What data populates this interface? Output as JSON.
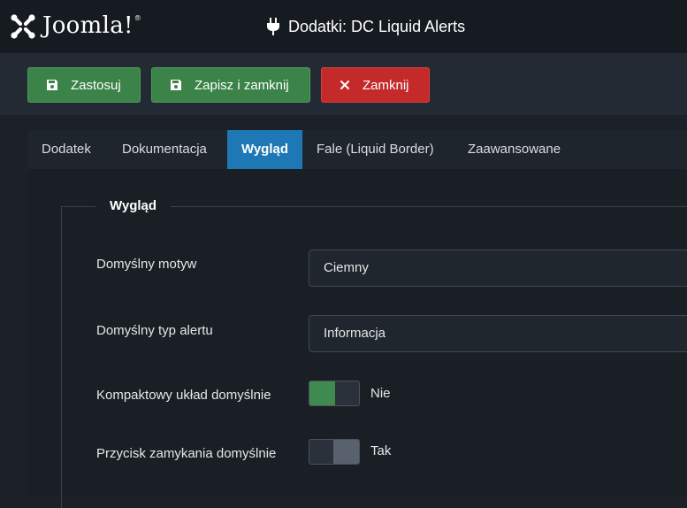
{
  "header": {
    "brand": "Joomla!",
    "brand_reg": "®",
    "title": "Dodatki: DC Liquid Alerts"
  },
  "toolbar": {
    "apply_label": "Zastosuj",
    "save_close_label": "Zapisz i zamknij",
    "close_label": "Zamknij"
  },
  "tabs": [
    {
      "label": "Dodatek"
    },
    {
      "label": "Dokumentacja"
    },
    {
      "label": "Wygląd",
      "active": true
    },
    {
      "label": "Fale (Liquid Border)"
    },
    {
      "label": "Zaawansowane"
    }
  ],
  "section": {
    "legend": "Wygląd",
    "fields": {
      "theme": {
        "label": "Domyślny motyw",
        "value": "Ciemny"
      },
      "alert_type": {
        "label": "Domyślny typ alertu",
        "value": "Informacja"
      },
      "compact": {
        "label": "Kompaktowy układ domyślnie",
        "state": "Nie"
      },
      "close_button": {
        "label": "Przycisk zamykania domyślnie",
        "state": "Tak"
      }
    }
  },
  "colors": {
    "success": "#3b8348",
    "danger": "#c52a2a",
    "active_tab": "#1d78b5"
  },
  "icons": {
    "brand": "joomla-logo-icon",
    "plugin": "plug-icon",
    "save": "floppy-disk-icon",
    "close": "close-icon"
  }
}
